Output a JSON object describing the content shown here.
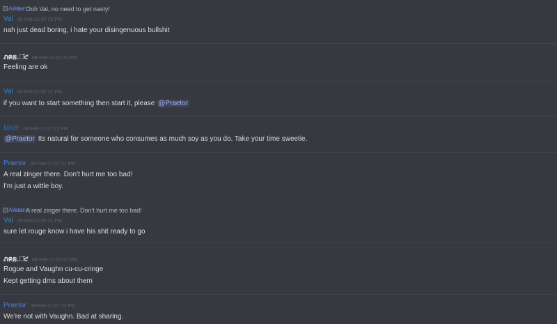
{
  "messages": [
    {
      "reply": {
        "author": "Praetor",
        "avatar_alt": "Avatar",
        "text": "Ooh Val, no need to get nasty!"
      },
      "author": "Val",
      "author_style": "val",
      "timestamp": "08-Feb-21 07:20 PM",
      "lines": [
        "nah just dead boring, i hate your disingenuous bullshit"
      ]
    },
    {
      "author": "ภคย.ภ̄ƈ",
      "author_style": "kano",
      "timestamp": "08-Feb-21 07:20 PM",
      "lines": [
        "Feeling are ok"
      ]
    },
    {
      "author": "Val",
      "author_style": "val",
      "timestamp": "08-Feb-21 07:21 PM",
      "lines": [
        {
          "text": "if you want to start something then start it, please ",
          "mention": "@Praetor"
        }
      ]
    },
    {
      "author": "MKR",
      "author_style": "mkr",
      "timestamp": "08-Feb-21 07:21 PM",
      "lines": [
        {
          "mention_first": "@Praetor",
          "text": " Its natural for someone who consumes as much soy as you do. Take your time sweetie."
        }
      ]
    },
    {
      "author": "Praetor",
      "author_style": "praetor",
      "timestamp": "08-Feb-21 07:21 PM",
      "lines": [
        "A real zinger there. Don't hurt me too bad!",
        "I'm just a wittle boy."
      ]
    },
    {
      "reply": {
        "author": "Praetor",
        "avatar_alt": "Avatar",
        "text": "A real zinger there. Don't hurt me too bad!"
      },
      "author": "Val",
      "author_style": "val",
      "timestamp": "08-Feb-21 07:21 PM",
      "lines": [
        "sure let rouge know i have his shit ready to go"
      ]
    },
    {
      "author": "ภคย.ภ̄ƈ",
      "author_style": "kano",
      "timestamp": "08-Feb-21 07:22 PM",
      "lines": [
        "Rogue and Vaughn cu-cu-cringe",
        "Kept getting dms about them"
      ]
    },
    {
      "author": "Praetor",
      "author_style": "praetor",
      "timestamp": "08-Feb-21 07:23 PM",
      "lines": [
        "We're not with Vaughn. Bad at sharing."
      ]
    }
  ]
}
